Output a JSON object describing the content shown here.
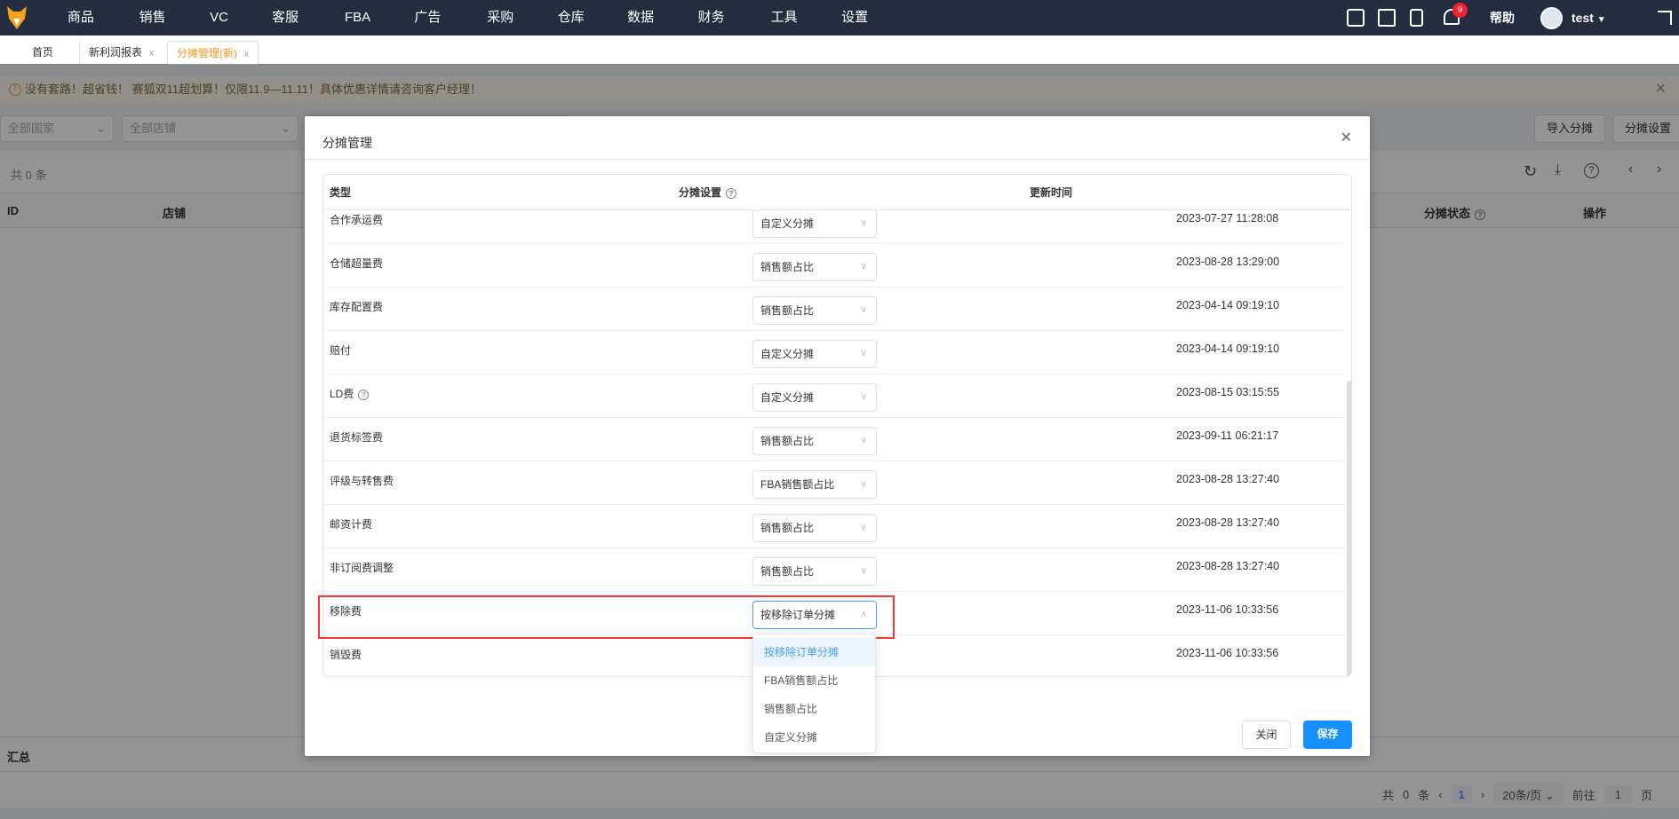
{
  "nav": {
    "items": [
      "商品",
      "销售",
      "VC",
      "客服",
      "FBA",
      "广告",
      "采购",
      "仓库",
      "数据",
      "财务",
      "工具",
      "设置"
    ],
    "notification_count": "9",
    "help": "帮助",
    "user": "test"
  },
  "tabs": [
    {
      "label": "首页"
    },
    {
      "label": "新利润报表",
      "close": "x"
    },
    {
      "label": "分摊管理(新)",
      "close": "x"
    }
  ],
  "notice": "没有套路！超省钱！ 赛狐双11超划算！仅限11.9—11.11！具体优惠详情请咨询客户经理！",
  "filters": {
    "country": "全部国家",
    "store": "全部店铺"
  },
  "actions": {
    "import": "导入分摊",
    "settings": "分摊设置"
  },
  "list": {
    "count": "共 0 条",
    "columns": [
      "ID",
      "店铺",
      "分摊状态",
      "操作"
    ],
    "summary": "汇总"
  },
  "pagination": {
    "total_prefix": "共",
    "total": "0",
    "total_suffix": "条",
    "current": "1",
    "page_size": "20条/页",
    "goto": "前往",
    "goto_value": "1",
    "page": "页"
  },
  "modal": {
    "title": "分摊管理",
    "columns": [
      "类型",
      "分摊设置",
      "更新时间"
    ],
    "rows": [
      {
        "type": "合作承运费",
        "setting": "自定义分摊",
        "time": "2023-07-27 11:28:08"
      },
      {
        "type": "仓储超量费",
        "setting": "销售额占比",
        "time": "2023-08-28 13:29:00"
      },
      {
        "type": "库存配置费",
        "setting": "销售额占比",
        "time": "2023-04-14 09:19:10"
      },
      {
        "type": "赔付",
        "setting": "自定义分摊",
        "time": "2023-04-14 09:19:10"
      },
      {
        "type": "LD费",
        "setting": "自定义分摊",
        "time": "2023-08-15 03:15:55",
        "help": true
      },
      {
        "type": "退货标签费",
        "setting": "销售额占比",
        "time": "2023-09-11 06:21:17"
      },
      {
        "type": "评级与转售费",
        "setting": "FBA销售额占比",
        "time": "2023-08-28 13:27:40"
      },
      {
        "type": "邮资计费",
        "setting": "销售额占比",
        "time": "2023-08-28 13:27:40"
      },
      {
        "type": "非订阅费调整",
        "setting": "销售额占比",
        "time": "2023-08-28 13:27:40"
      },
      {
        "type": "移除费",
        "setting": "按移除订单分摊",
        "time": "2023-11-06 10:33:56",
        "open": true
      },
      {
        "type": "销毁费",
        "setting": "",
        "time": "2023-11-06 10:33:56"
      }
    ],
    "dropdown_options": [
      "按移除订单分摊",
      "FBA销售额占比",
      "销售额占比",
      "自定义分摊"
    ],
    "close_button": "关闭",
    "save_button": "保存"
  },
  "colors": {
    "nav_bg": "#232d3f",
    "accent": "#409eff",
    "primary_button": "#1890ff",
    "tab_active": "#f7941d",
    "highlight": "#ff3333"
  }
}
